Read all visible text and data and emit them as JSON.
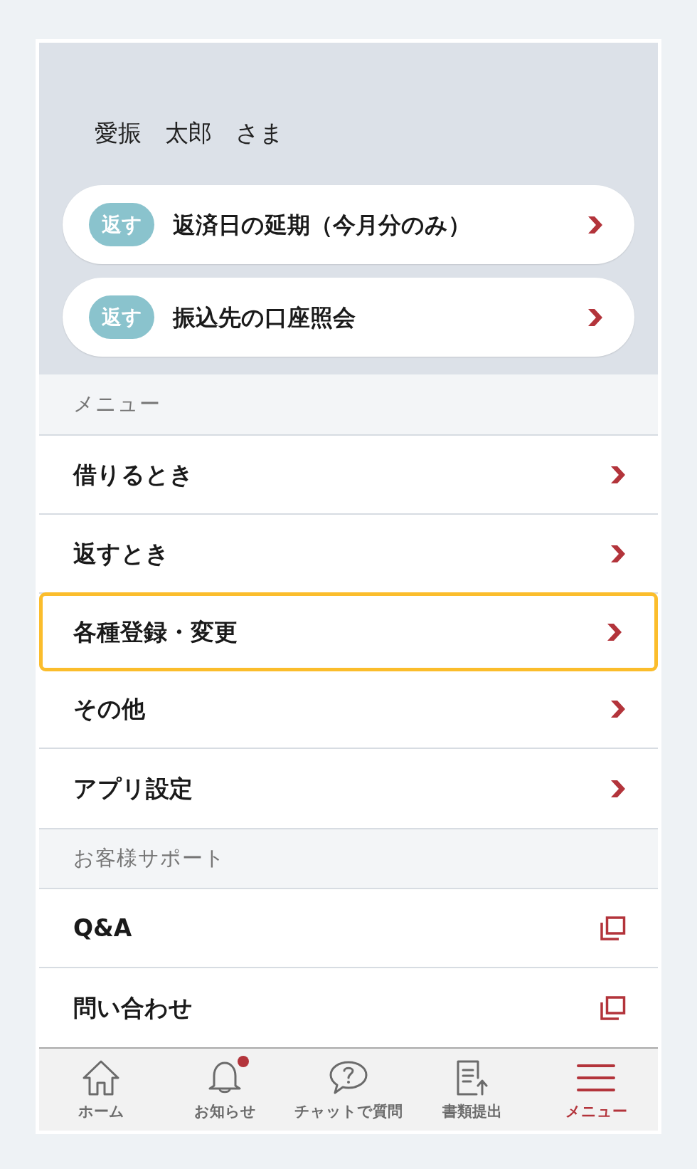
{
  "greeting": "愛振　太郎　さま",
  "quick_actions": [
    {
      "badge": "返す",
      "label": "返済日の延期（今月分のみ）"
    },
    {
      "badge": "返す",
      "label": "振込先の口座照会"
    }
  ],
  "sections": [
    {
      "heading": "メニュー",
      "items": [
        {
          "label": "借りるとき",
          "kind": "chevron",
          "highlighted": false
        },
        {
          "label": "返すとき",
          "kind": "chevron",
          "highlighted": false
        },
        {
          "label": "各種登録・変更",
          "kind": "chevron",
          "highlighted": true
        },
        {
          "label": "その他",
          "kind": "chevron",
          "highlighted": false
        },
        {
          "label": "アプリ設定",
          "kind": "chevron",
          "highlighted": false
        }
      ]
    },
    {
      "heading": "お客様サポート",
      "items": [
        {
          "label": "Q&A",
          "kind": "external",
          "highlighted": false
        },
        {
          "label": "問い合わせ",
          "kind": "external",
          "highlighted": false
        }
      ]
    }
  ],
  "bottom_nav": [
    {
      "label": "ホーム",
      "selected": false,
      "unread": false
    },
    {
      "label": "お知らせ",
      "selected": false,
      "unread": true
    },
    {
      "label": "チャットで質問",
      "selected": false,
      "unread": false
    },
    {
      "label": "書類提出",
      "selected": false,
      "unread": false
    },
    {
      "label": "メニュー",
      "selected": true,
      "unread": false
    }
  ]
}
